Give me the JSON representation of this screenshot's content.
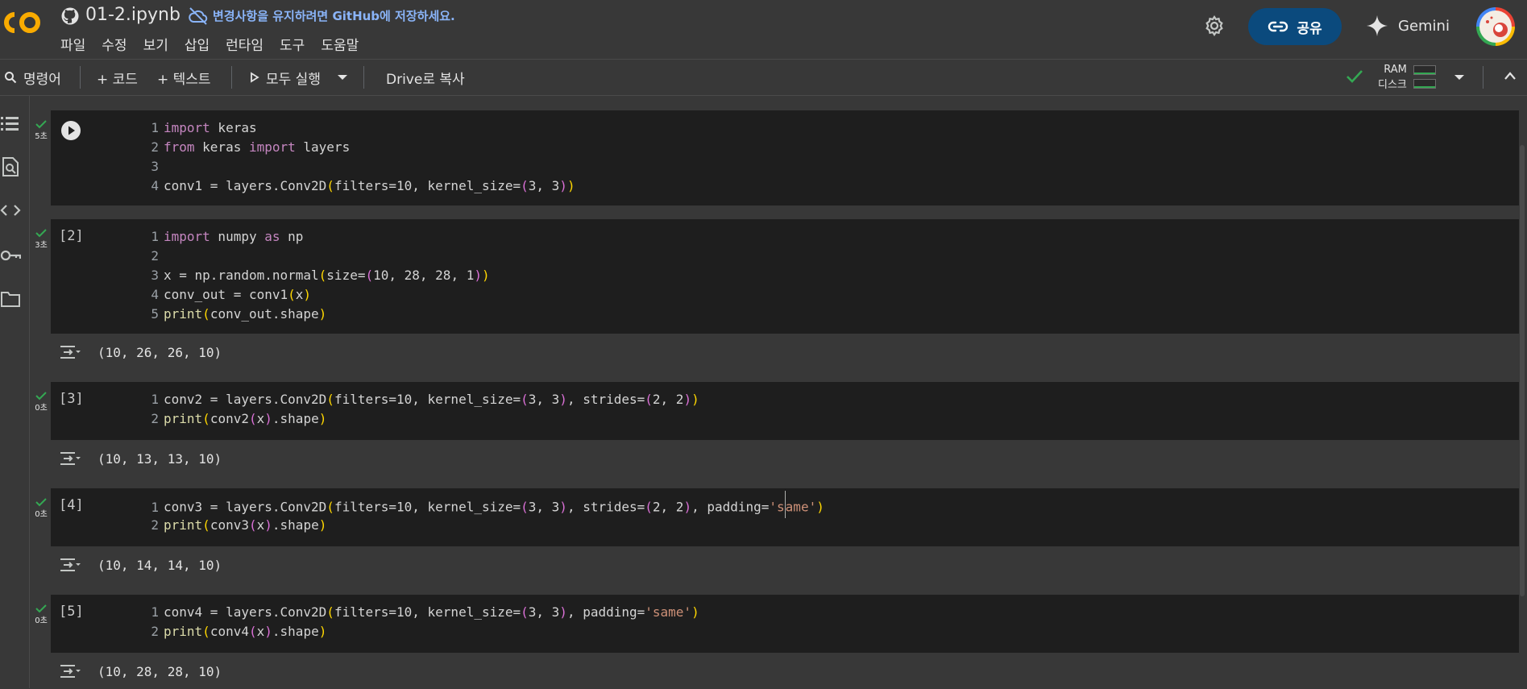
{
  "header": {
    "notebook_title": "01-2.ipynb",
    "save_message": "변경사항을 유지하려면 GitHub에 저장하세요.",
    "menu": [
      "파일",
      "수정",
      "보기",
      "삽입",
      "런타임",
      "도구",
      "도움말"
    ],
    "share_label": "공유",
    "gemini_label": "Gemini"
  },
  "toolbar": {
    "command_label": "명령어",
    "add_code_label": "+ 코드",
    "add_text_label": "+ 텍스트",
    "run_all_label": "모두 실행",
    "copy_drive_label": "Drive로 복사",
    "ram_label": "RAM",
    "disk_label": "디스크"
  },
  "cells": [
    {
      "exec": "",
      "time": "5초",
      "lines": [
        "import keras",
        "from keras import layers",
        "",
        "conv1 = layers.Conv2D(filters=10, kernel_size=(3, 3))"
      ],
      "output": ""
    },
    {
      "exec": "[2]",
      "time": "3초",
      "lines": [
        "import numpy as np",
        "",
        "x = np.random.normal(size=(10, 28, 28, 1))",
        "conv_out = conv1(x)",
        "print(conv_out.shape)"
      ],
      "output": "(10, 26, 26, 10)"
    },
    {
      "exec": "[3]",
      "time": "0초",
      "lines": [
        "conv2 = layers.Conv2D(filters=10, kernel_size=(3, 3), strides=(2, 2))",
        "print(conv2(x).shape)"
      ],
      "output": "(10, 13, 13, 10)"
    },
    {
      "exec": "[4]",
      "time": "0초",
      "lines": [
        "conv3 = layers.Conv2D(filters=10, kernel_size=(3, 3), strides=(2, 2), padding='same')",
        "print(conv3(x).shape)"
      ],
      "output": "(10, 14, 14, 10)"
    },
    {
      "exec": "[5]",
      "time": "0초",
      "lines": [
        "conv4 = layers.Conv2D(filters=10, kernel_size=(3, 3), padding='same')",
        "print(conv4(x).shape)"
      ],
      "output": "(10, 28, 28, 10)"
    }
  ],
  "line_numbers": [
    "1",
    "2",
    "3",
    "4",
    "5"
  ],
  "colors": {
    "background": "#383838",
    "cell": "#1e1e1e",
    "keyword": "#c586c0",
    "string": "#ce9178",
    "bracket": "#ffd700",
    "share": "#0b4a7d",
    "link": "#8ab4f8",
    "ok": "#34a853"
  },
  "icons": [
    "colab-logo",
    "github-icon",
    "cloud-off-icon",
    "gear-icon",
    "link-icon",
    "gemini-spark-icon",
    "search-icon",
    "play-icon",
    "chevron-down-icon",
    "check-icon",
    "chevron-up-icon",
    "toc-icon",
    "find-icon",
    "code-icon",
    "key-icon",
    "folder-icon",
    "output-toggle-icon"
  ]
}
